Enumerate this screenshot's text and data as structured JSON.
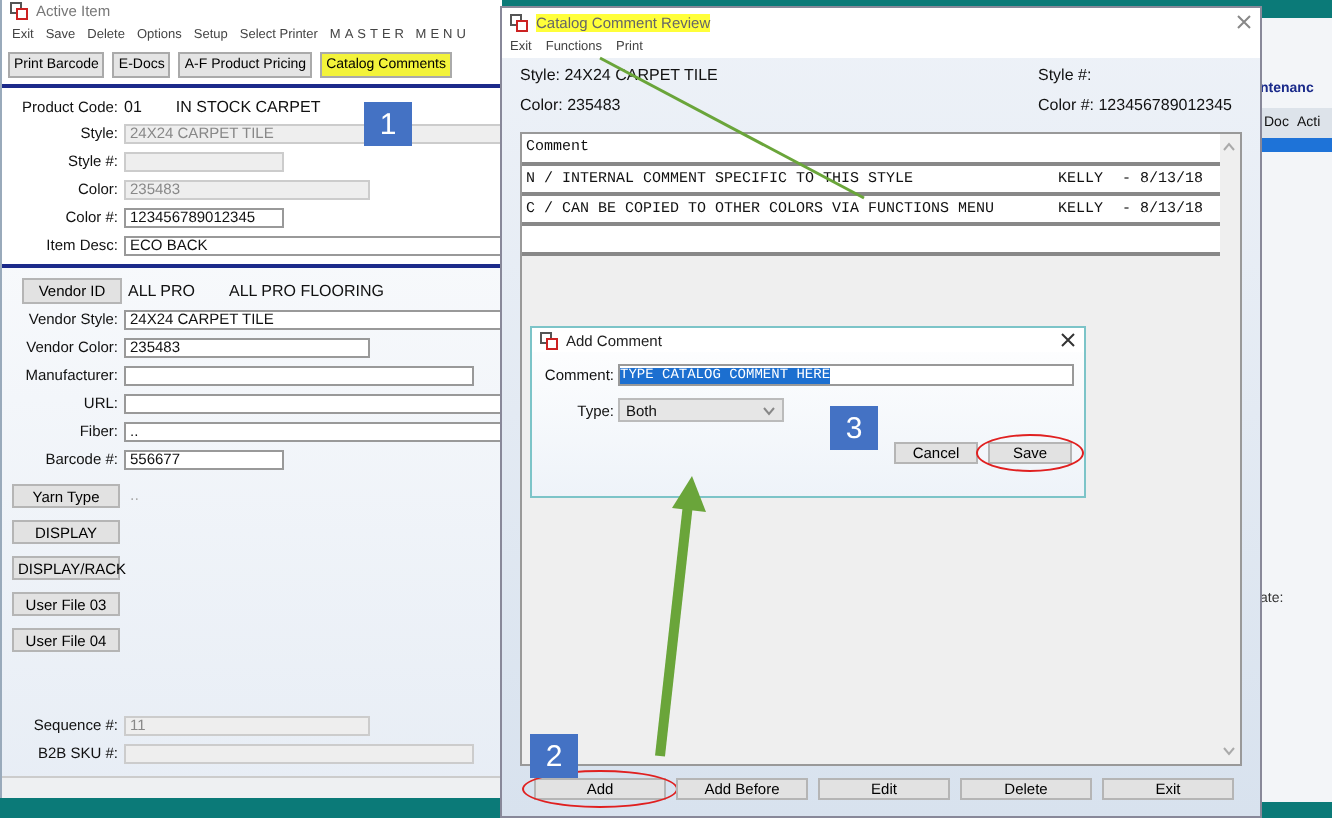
{
  "active_item": {
    "title": "Active Item",
    "menu": [
      "Exit",
      "Save",
      "Delete",
      "Options",
      "Setup",
      "Select Printer",
      "MASTER MENU"
    ],
    "toolbar": [
      {
        "label": "Print Barcode",
        "highlighted": false
      },
      {
        "label": "E-Docs",
        "highlighted": false
      },
      {
        "label": "A-F Product Pricing",
        "highlighted": false
      },
      {
        "label": "Catalog Comments",
        "highlighted": true
      }
    ],
    "product_code": {
      "label": "Product Code:",
      "code": "01",
      "name": "IN STOCK CARPET"
    },
    "fields": [
      {
        "label": "Style:",
        "value": "24X24 CARPET TILE",
        "kind": "readonly"
      },
      {
        "label": "Style #:",
        "kind": "readonly"
      },
      {
        "label": "Color:",
        "value": "235483",
        "kind": "readonly"
      },
      {
        "label": "Color #:",
        "value": "123456789012345",
        "kind": "input"
      },
      {
        "label": "Item Desc:",
        "value": "ECO BACK",
        "kind": "input"
      }
    ],
    "vendor": {
      "button": "Vendor ID",
      "id": "ALL PRO",
      "name": "ALL PRO FLOORING"
    },
    "vendor_fields": [
      {
        "label": "Vendor Style:",
        "value": "24X24 CARPET TILE",
        "kind": "input"
      },
      {
        "label": "Vendor Color:",
        "value": "235483",
        "kind": "input"
      },
      {
        "label": "Manufacturer:",
        "kind": "input"
      },
      {
        "label": "URL:",
        "kind": "input"
      },
      {
        "label": "Fiber:",
        "value": "..",
        "kind": "input"
      },
      {
        "label": "Barcode #:",
        "value": "556677",
        "kind": "input"
      }
    ],
    "yarn": {
      "button": "Yarn Type",
      "value": ".."
    },
    "side_buttons": [
      "DISPLAY",
      "DISPLAY/RACK",
      "User File 03",
      "User File 04"
    ],
    "bottom_fields": [
      {
        "label": "Sequence #:",
        "value": "11",
        "kind": "readonly"
      },
      {
        "label": "B2B SKU #:",
        "kind": "readonly"
      }
    ]
  },
  "back_window": {
    "heading": "ntenanc",
    "columns": [
      "Doc",
      "Acti"
    ],
    "label": "ate:"
  },
  "review": {
    "title": "Catalog Comment Review",
    "title_highlighted": true,
    "menu": [
      "Exit",
      "Functions",
      "Print"
    ],
    "style_text": "Style: 24X24 CARPET TILE",
    "style_no": "Style #:",
    "color_text": "Color: 235483",
    "color_no": "Color #: 123456789012345",
    "table": {
      "column": "Comment",
      "rows": [
        {
          "text": "N / INTERNAL COMMENT SPECIFIC TO THIS STYLE",
          "user": "KELLY",
          "date": "- 8/13/18"
        },
        {
          "text": "C / CAN BE COPIED TO OTHER COLORS VIA FUNCTIONS MENU",
          "user": "KELLY",
          "date": "- 8/13/18"
        }
      ]
    },
    "buttons": [
      {
        "label": "Add",
        "circled": true
      },
      {
        "label": "Add Before",
        "circled": false
      },
      {
        "label": "Edit",
        "circled": false
      },
      {
        "label": "Delete",
        "circled": false
      },
      {
        "label": "Exit",
        "circled": false
      }
    ]
  },
  "dialog": {
    "title": "Add Comment",
    "comment_label": "Comment:",
    "comment": "TYPE CATALOG COMMENT HERE",
    "comment_selected": true,
    "type_label": "Type:",
    "type": "Both",
    "buttons": [
      {
        "label": "Cancel",
        "circled": false
      },
      {
        "label": "Save",
        "circled": true
      }
    ]
  },
  "callouts": [
    "1",
    "2",
    "3"
  ]
}
